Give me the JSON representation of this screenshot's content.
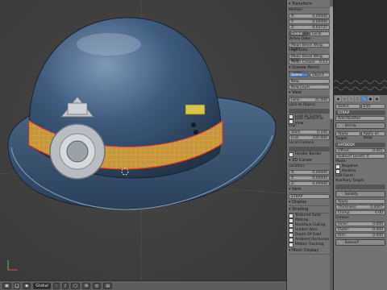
{
  "npanel": {
    "transform": {
      "title": "Transform",
      "median_label": "Median:",
      "x": "0.00000",
      "y": "0.00000",
      "z": "0.03737",
      "global": "Global",
      "local": "Local",
      "vertex_data": "Vertex Data:",
      "mean_bevel_weight": "Mean Bevel Weig: 0.00",
      "edge_data": "Edge Data:",
      "mean_bevel_weight2": "Mean Bevel Weig: 0.00",
      "mean_crease": "Mean Crease:",
      "mean_crease_value": "0.13"
    },
    "grease_pencil": {
      "title": "Grease Pencil Layers",
      "scene": "Scene",
      "object": "Object",
      "new": "New",
      "new_layer": "New Layer"
    },
    "view": {
      "title": "View",
      "lens_label": "Lens:",
      "lens": "35.000",
      "lock_to_object": "Lock to Object:",
      "lock_to_cursor": "Lock to Cursor",
      "lock_camera": "Lock Camera to View",
      "clip_label": "Clip:",
      "start_label": "Start:",
      "start": "0.100",
      "end_label": "End:",
      "end": "100.000",
      "local_camera": "Local Camera:",
      "render_border": "Render Border"
    },
    "cursor": {
      "title": "3D Cursor",
      "location": "Location:",
      "x": "0.00000",
      "y": "0.00000",
      "z": "0.00000"
    },
    "item": {
      "title": "Item",
      "name": "STRAP"
    },
    "display": {
      "title": "Display"
    },
    "shading": {
      "title": "Shading",
      "textured_solid": "Textured Solid",
      "matcap": "Matcap",
      "backface_culling": "Backface Culling",
      "hidden_wire": "Hidden Wire",
      "depth_of_field": "Depth Of Field",
      "ambient_occlusion": "Ambient Occlusion",
      "motion_tracking": "Motion Tracking"
    },
    "mesh_display": {
      "title": "Mesh Display"
    }
  },
  "outliner": {
    "items": [
      "View",
      "Search",
      "All Scen"
    ]
  },
  "properties": {
    "search_label": "Select",
    "edit_label": "Edit",
    "object_name": "STRAP",
    "add_modifier": "Add Modifier",
    "shrinkwrap": {
      "name": "Shrink",
      "apply": "Apply",
      "apply_as_shape": "Apply as Shap",
      "target_label": "Target:",
      "target": "HATBODY",
      "offset_label": "Offset:",
      "offset": "0.001",
      "subsurf_levels": "Subsurf Levels: 0",
      "mode_label": "Mode:",
      "negative": "Negative",
      "positive": "Positive",
      "cull_faces": "Cull Faces:",
      "auxiliary_target": "Auxiliary Target:"
    },
    "solidify": {
      "name": "Solidify",
      "apply": "Apply",
      "thickness_label": "Thickness:",
      "thickness": "0.0007",
      "clamp_label": "Clamp:",
      "clamp": "0.00",
      "crease_label": "Crease:",
      "inner_label": "Inner:",
      "inner": "0.000",
      "outer_label": "Outer:",
      "outer": "0.000",
      "rim_label": "Rim:",
      "rim": "0.000"
    },
    "subsurf": {
      "name": "Subsurf"
    }
  },
  "viewport_header": {
    "mode": "Global",
    "view_label": "Object Mode"
  },
  "colors": {
    "hat": "#3c5a7c",
    "strap": "#c89642",
    "accent": "#5680c2",
    "panel": "#727272"
  }
}
